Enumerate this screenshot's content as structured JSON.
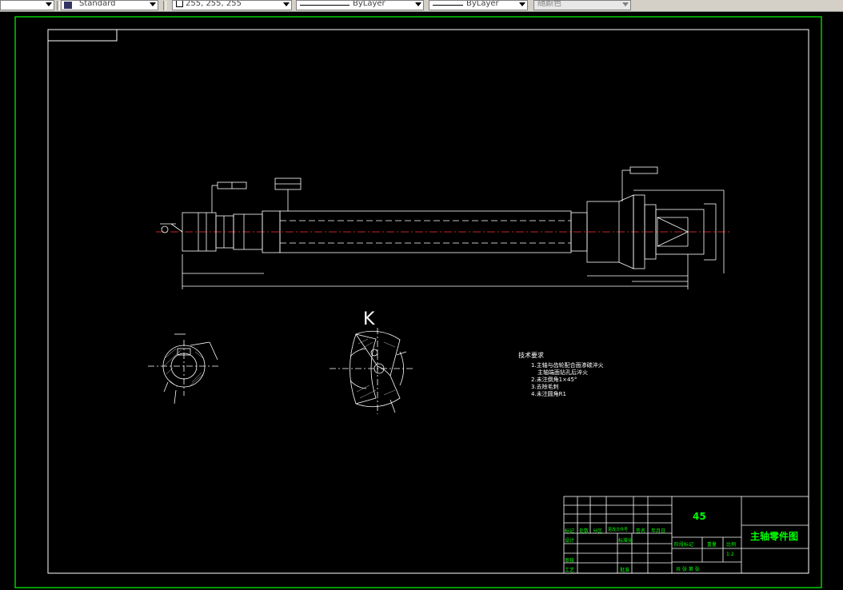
{
  "toolbar": {
    "text_style": "Standard",
    "color_value": "255, 255, 255",
    "linetype": "ByLayer",
    "lineweight": "ByLayer",
    "plot_style": "随颜色"
  },
  "drawing": {
    "section_label": "K",
    "tech_notes": {
      "title": "技术要求",
      "items": [
        "1.主轴与齿轮配合面渗碳淬火",
        "主轴端面钻孔后淬火",
        "2.未注倒角1×45°",
        "3.去除毛刺",
        "4.未注圆角R1"
      ]
    },
    "title_block": {
      "material": "45",
      "drawing_name": "主轴零件图",
      "scale": "1:2",
      "labels": {
        "mark": "标记",
        "count": "处数",
        "zone": "分区",
        "change_doc": "更改文件号",
        "signature": "签名",
        "date": "年月日",
        "design": "设计",
        "standardize": "标准化",
        "review": "审核",
        "process": "工艺",
        "approve": "批准",
        "stage_mark": "阶段标记",
        "weight": "重量",
        "ratio": "比例",
        "sheets": "共 张 第 张"
      }
    }
  },
  "colors": {
    "background": "#000000",
    "frame": "#00ff00",
    "geometry": "#ffffff",
    "centerline": "#ff0000",
    "title_text": "#00ff00"
  }
}
